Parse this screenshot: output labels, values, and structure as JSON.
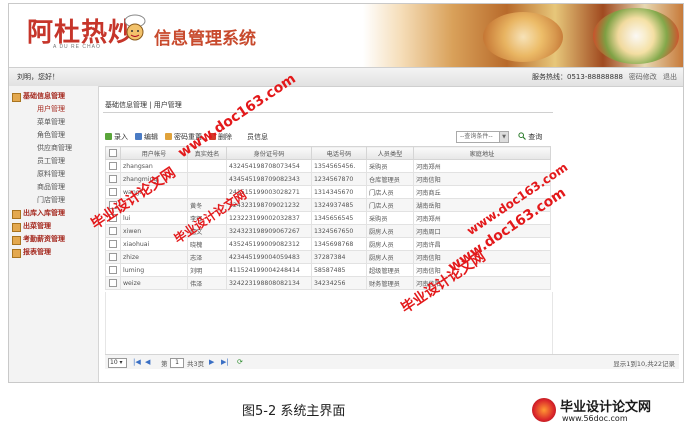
{
  "header": {
    "logo_text": "阿杜热炒",
    "logo_sub": "A DU RE CHAO",
    "system_title": "信息管理系统"
  },
  "topbar": {
    "greeting": "刘明，您好！",
    "hotline": "服务热线：0513-88888888",
    "links": [
      "密码修改",
      "退出"
    ]
  },
  "sidebar": {
    "groups": [
      {
        "label": "基础信息管理",
        "items": [
          "用户管理",
          "菜单管理",
          "角色管理",
          "供应商管理",
          "员工管理",
          "原料管理",
          "商品管理",
          "门店管理"
        ]
      },
      {
        "label": "出库入库管理",
        "items": []
      },
      {
        "label": "出菜管理",
        "items": []
      },
      {
        "label": "考勤薪资管理",
        "items": []
      },
      {
        "label": "报表管理",
        "items": []
      }
    ]
  },
  "breadcrumb": "基础信息管理 | 用户管理",
  "toolbar": {
    "buttons": [
      "录入",
      "编辑",
      "密码重置",
      "删除",
      "员信息"
    ],
    "query_select": "--查询条件--",
    "query_button": "查询"
  },
  "table": {
    "columns": [
      "用户帐号",
      "真实姓名",
      "身份证号码",
      "电话号码",
      "人员类型",
      "家庭地址"
    ],
    "rows": [
      [
        "zhangsan",
        "",
        "432454198708073454",
        "1354565456.",
        "采购员",
        "河南郑州"
      ],
      [
        "zhangming",
        "",
        "434545198709082343",
        "1234567870",
        "仓库管理员",
        "河南信阳"
      ],
      [
        "wangf",
        "",
        "241515199003028271",
        "1314345670",
        "门店人员",
        "河南商丘"
      ],
      [
        "",
        "黄冬",
        "324323198709021232",
        "1324937485",
        "门店人员",
        "湖南岳阳"
      ],
      [
        "lui",
        "李辉",
        "123223199002032837",
        "1345656545",
        "采购员",
        "河南郑州"
      ],
      [
        "xiwen",
        "僖文",
        "324323198909067267",
        "1324567650",
        "厨房人员",
        "河南周口"
      ],
      [
        "xiaohuai",
        "晓槐",
        "435245199009082312",
        "1345698768",
        "厨房人员",
        "河南许昌"
      ],
      [
        "zhize",
        "志泽",
        "423445199004059483",
        "37287384",
        "厨房人员",
        "河南信阳"
      ],
      [
        "luming",
        "刘明",
        "411524199004248414",
        "58587485",
        "超级管理员",
        "河南信阳"
      ],
      [
        "weize",
        "伟泽",
        "324223198808082134",
        "34234256",
        "财务管理员",
        "河南信阳"
      ]
    ]
  },
  "pager": {
    "page_size": "10",
    "page_label": "第",
    "page": "1",
    "total_pages": "共3页",
    "summary": "显示1到10,共22记录"
  },
  "watermarks": [
    "www.doc163.com",
    "毕业设计论文网",
    "毕业设计论文网",
    "www.doc163.com",
    "毕业设计论文网",
    "www.doc163.com"
  ],
  "caption": "图5-2  系统主界面",
  "footer_logo": {
    "title": "毕业设计论文网",
    "url": "www.56doc.com"
  },
  "colors": {
    "accent": "#c6352a",
    "menu_text": "#a5291f",
    "watermark": "#e3191b"
  }
}
